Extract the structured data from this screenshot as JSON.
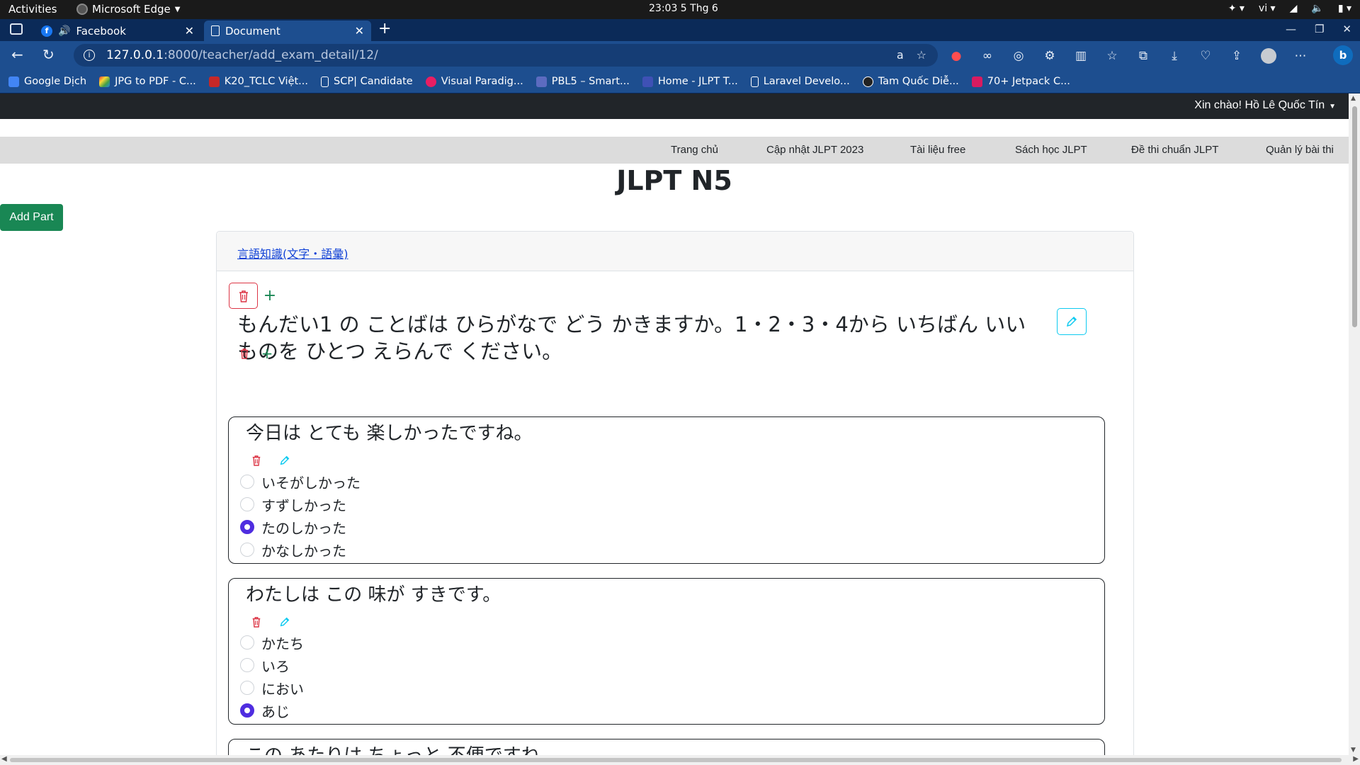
{
  "system": {
    "activities": "Activities",
    "app_name": "Microsoft Edge",
    "clock": "23:03  5 Thg 6",
    "lang": "vi"
  },
  "browser": {
    "tabs": [
      {
        "label": "Facebook"
      },
      {
        "label": "Document"
      }
    ],
    "url_host": "127.0.0.1",
    "url_path": ":8000/teacher/add_exam_detail/12/",
    "bookmarks": [
      {
        "label": "Google Dịch",
        "color": "#4285f4"
      },
      {
        "label": "JPG to PDF - C...",
        "color": "#e53935"
      },
      {
        "label": "K20_TCLC Việt...",
        "color": "#c62828"
      },
      {
        "label": "SCP| Candidate",
        "color": "#ffffff"
      },
      {
        "label": "Visual Paradig...",
        "color": "#e91e63"
      },
      {
        "label": "PBL5 – Smart...",
        "color": "#5c6bc0"
      },
      {
        "label": "Home - JLPT T...",
        "color": "#3f51b5"
      },
      {
        "label": "Laravel Develo...",
        "color": "#ffffff"
      },
      {
        "label": "Tam Quốc Diễ...",
        "color": "#222222"
      },
      {
        "label": "70+ Jetpack C...",
        "color": "#d81b60"
      }
    ]
  },
  "site": {
    "greeting": "Xin chào! Hồ Lê Quốc Tín",
    "nav": [
      {
        "label": "Trang chủ"
      },
      {
        "label": "Cập nhật JLPT 2023"
      },
      {
        "label": "Tài liệu free"
      },
      {
        "label": "Sách học JLPT"
      },
      {
        "label": "Đề thi chuẩn JLPT"
      },
      {
        "label": "Quản lý bài thi"
      }
    ],
    "page_title": "JLPT N5",
    "add_part_label": "Add Part",
    "section_link": "言語知識(文字・語彙)",
    "part_title": "もんだい1 の ことばは ひらがなで どう かきますか。1・2・3・4から いちばん いい ものを ひとつ えらんで ください。",
    "questions": [
      {
        "text": "今日は とても 楽しかったですね。",
        "options": [
          {
            "label": "いそがしかった",
            "checked": false
          },
          {
            "label": "すずしかった",
            "checked": false
          },
          {
            "label": "たのしかった",
            "checked": true
          },
          {
            "label": "かなしかった",
            "checked": false
          }
        ]
      },
      {
        "text": "わたしは この 味が すきです。",
        "options": [
          {
            "label": "かたち",
            "checked": false
          },
          {
            "label": "いろ",
            "checked": false
          },
          {
            "label": "におい",
            "checked": false
          },
          {
            "label": "あじ",
            "checked": true
          }
        ]
      },
      {
        "text": "この あたりは ちょっと 不便ですね。",
        "options": []
      }
    ]
  },
  "colors": {
    "accent_radio": "#4f2de0",
    "add_part_bg": "#198754",
    "delete_red": "#dc3545",
    "edit_cyan": "#0dcaf0",
    "link_blue": "#0d3fd6"
  },
  "icons": [
    "trash-icon",
    "plus-icon",
    "pencil-icon"
  ]
}
